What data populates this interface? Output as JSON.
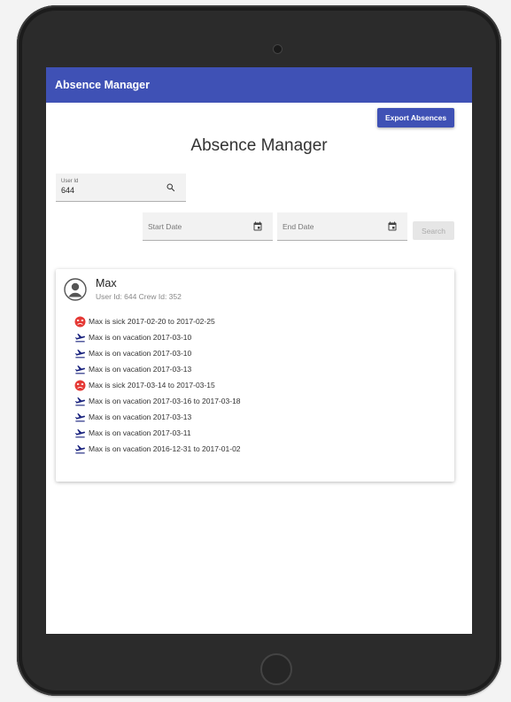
{
  "appbar": {
    "title": "Absence Manager"
  },
  "toolbar": {
    "export_label": "Export Absences"
  },
  "page": {
    "title": "Absence Manager"
  },
  "search": {
    "user_id_label": "User Id",
    "user_id_value": "644",
    "start_date_placeholder": "Start Date",
    "end_date_placeholder": "End Date",
    "search_label": "Search"
  },
  "user": {
    "name": "Max",
    "meta": "User Id: 644 Crew Id: 352"
  },
  "absences": [
    {
      "type": "sick",
      "icon": "sick-icon",
      "text": "Max is sick 2017-02-20 to 2017-02-25"
    },
    {
      "type": "vacation",
      "icon": "flight-icon",
      "text": "Max is on vacation 2017-03-10"
    },
    {
      "type": "vacation",
      "icon": "flight-icon",
      "text": "Max is on vacation 2017-03-10"
    },
    {
      "type": "vacation",
      "icon": "flight-icon",
      "text": "Max is on vacation 2017-03-13"
    },
    {
      "type": "sick",
      "icon": "sick-icon",
      "text": "Max is sick 2017-03-14 to 2017-03-15"
    },
    {
      "type": "vacation",
      "icon": "flight-icon",
      "text": "Max is on vacation 2017-03-16 to 2017-03-18"
    },
    {
      "type": "vacation",
      "icon": "flight-icon",
      "text": "Max is on vacation 2017-03-13"
    },
    {
      "type": "vacation",
      "icon": "flight-icon",
      "text": "Max is on vacation 2017-03-11"
    },
    {
      "type": "vacation",
      "icon": "flight-icon",
      "text": "Max is on vacation 2016-12-31 to 2017-01-02"
    }
  ],
  "colors": {
    "primary": "#3f51b5",
    "sick": "#e53935",
    "vacation": "#1a237e"
  }
}
